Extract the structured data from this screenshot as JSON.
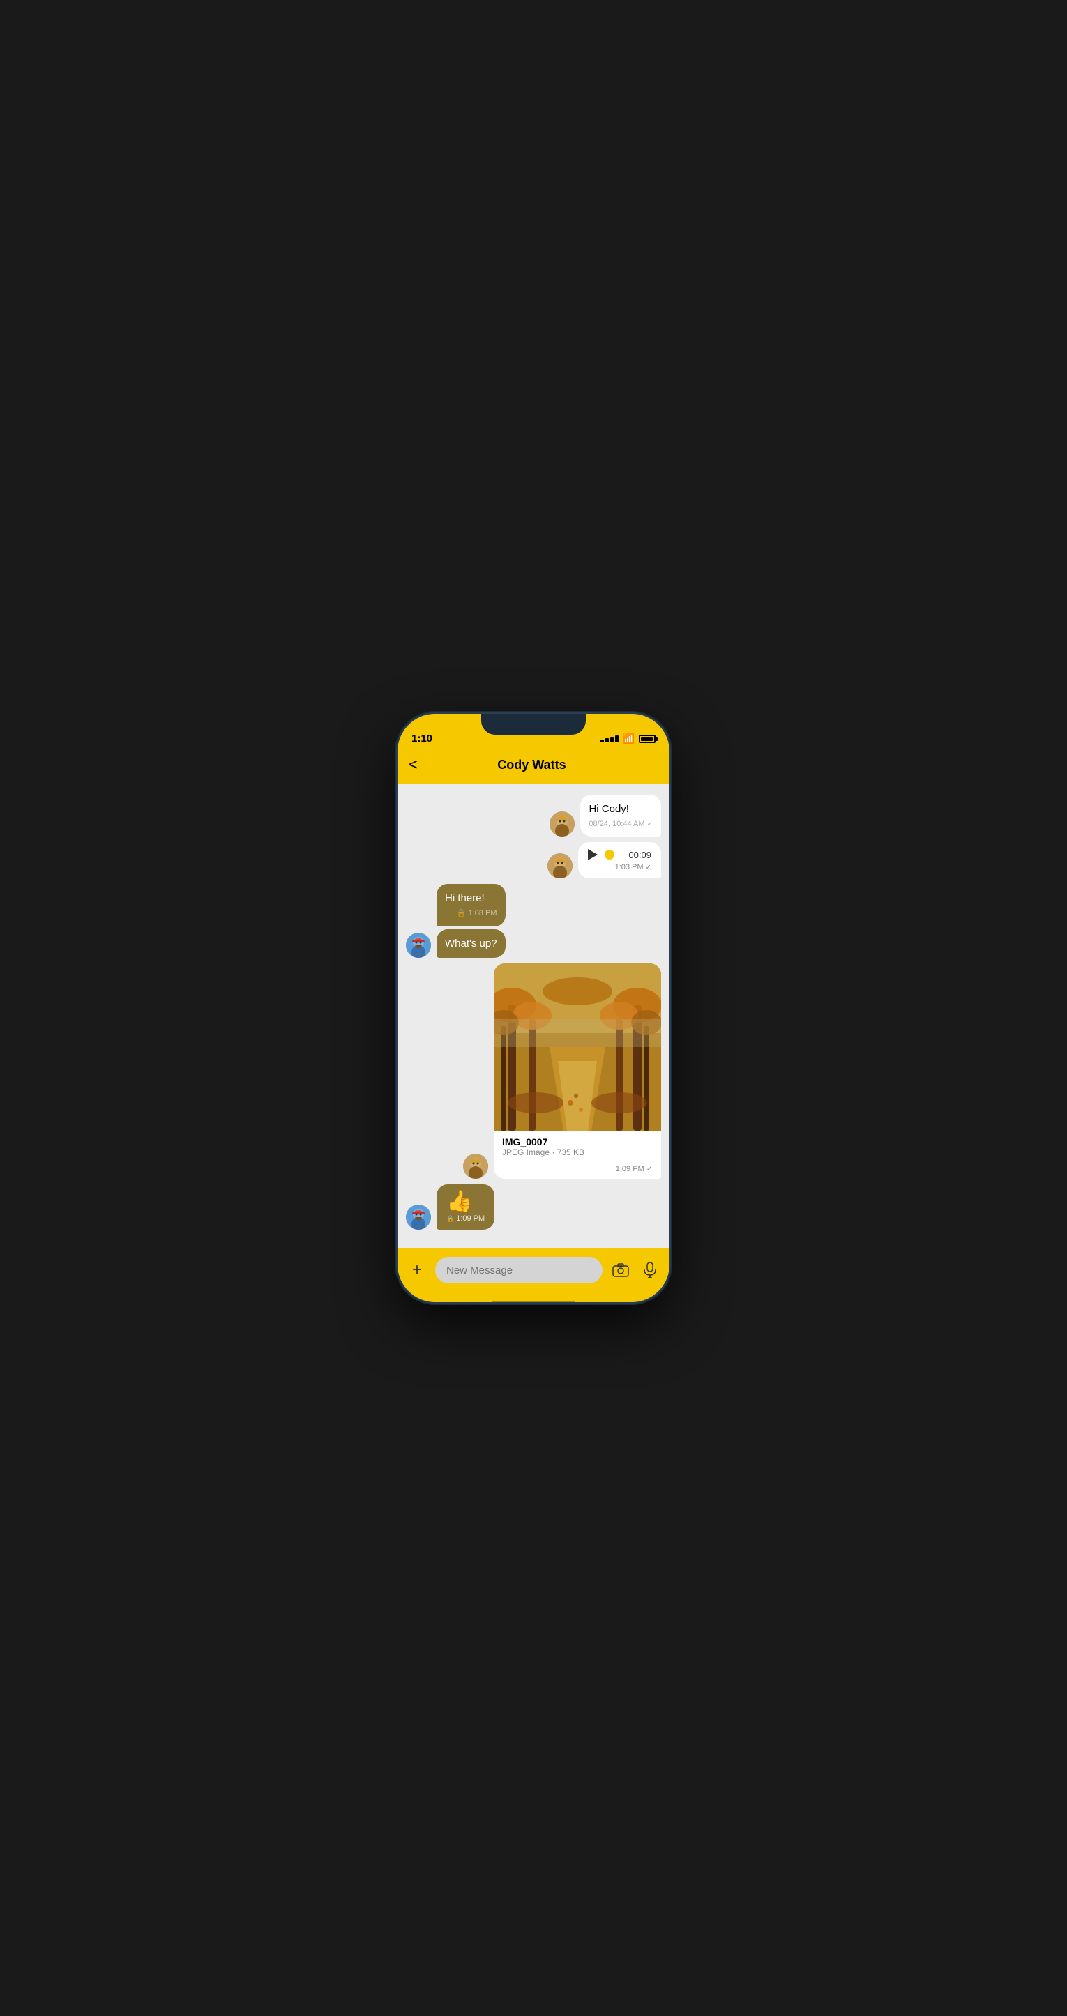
{
  "status": {
    "time": "1:10",
    "signal_label": "signal",
    "wifi_label": "wifi",
    "battery_label": "battery"
  },
  "header": {
    "back_label": "<",
    "title": "Cody Watts"
  },
  "messages": [
    {
      "id": "msg1",
      "type": "text",
      "direction": "outgoing",
      "text": "Hi Cody!",
      "time": "08/24, 10:44 AM",
      "check": "✓"
    },
    {
      "id": "msg2",
      "type": "voice",
      "direction": "outgoing",
      "duration": "00:09",
      "time": "1:03 PM",
      "check": "✓"
    },
    {
      "id": "msg3",
      "type": "text",
      "direction": "incoming",
      "text": "Hi there!",
      "time": "1:08 PM",
      "lock": "🔒"
    },
    {
      "id": "msg4",
      "type": "text",
      "direction": "incoming",
      "text": "What's up?",
      "time": ""
    },
    {
      "id": "msg5",
      "type": "image",
      "direction": "outgoing",
      "filename": "IMG_0007",
      "filetype": "JPEG Image",
      "filesize": "735 KB",
      "time": "1:09 PM",
      "check": "✓"
    },
    {
      "id": "msg6",
      "type": "emoji",
      "direction": "incoming",
      "emoji": "👍",
      "time": "1:09 PM",
      "lock": "🔒"
    }
  ],
  "input": {
    "placeholder": "New Message",
    "add_label": "+",
    "camera_label": "camera",
    "mic_label": "microphone"
  }
}
